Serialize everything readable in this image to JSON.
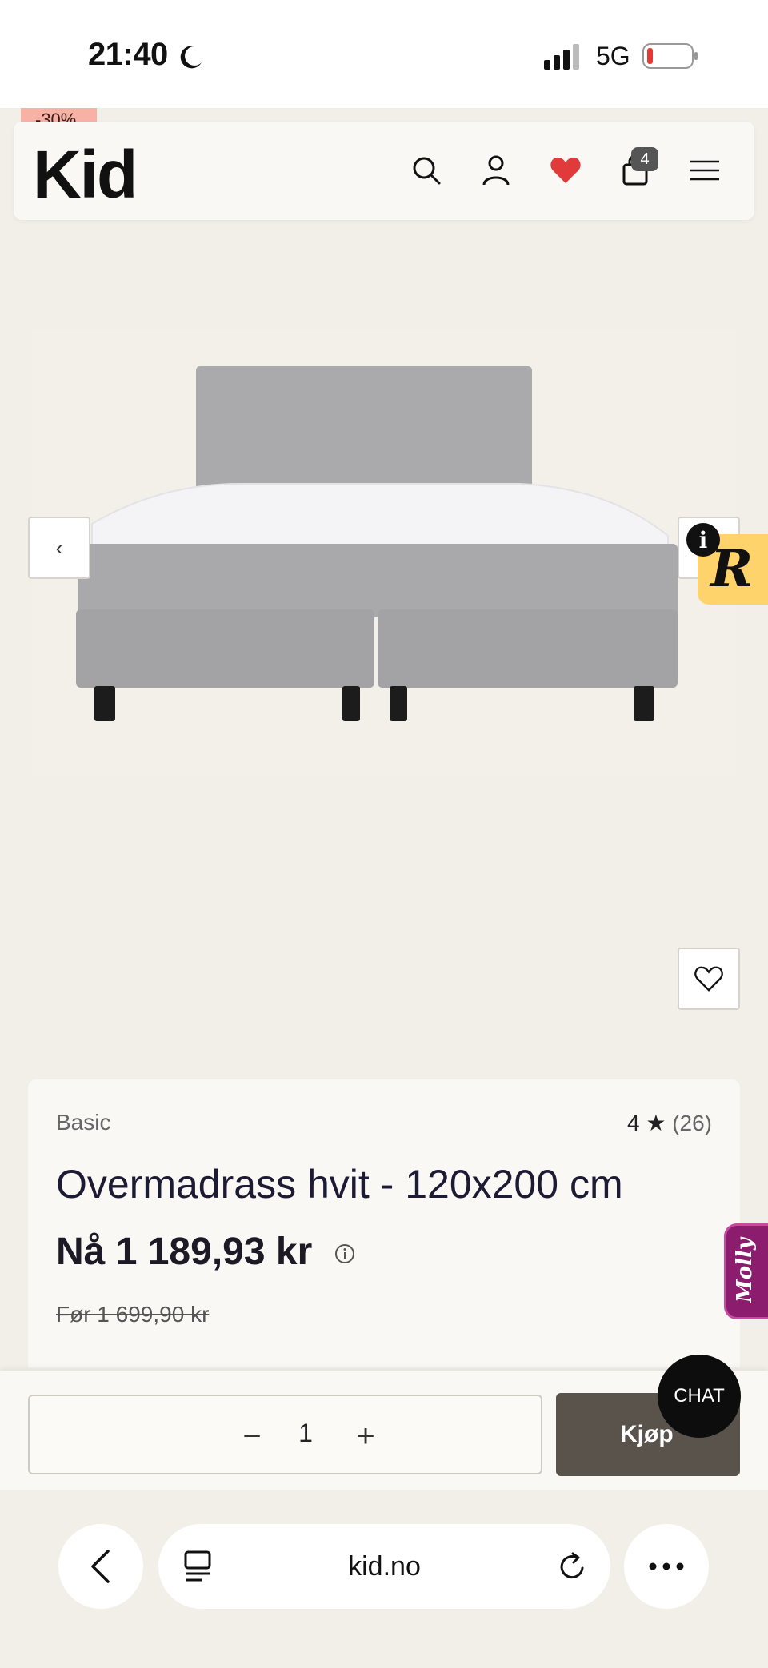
{
  "status_bar": {
    "time": "21:40",
    "network": "5G"
  },
  "sale_badge": "-30%",
  "header": {
    "logo": "Kid",
    "cart_count": "4"
  },
  "product": {
    "brand": "Basic",
    "rating": "4 ★",
    "rating_count": "(26)",
    "title": "Overmadrass hvit - 120x200 cm",
    "price_now": "Nå 1 189,93 kr",
    "price_before": "Før 1 699,90 kr"
  },
  "widgets": {
    "r_letter": "R",
    "molly": "Molly",
    "chat": "CHAT"
  },
  "buy_bar": {
    "quantity": "1",
    "buy_label": "Kjøp"
  },
  "browser": {
    "url": "kid.no"
  },
  "colors": {
    "accent_heart": "#e03a3a",
    "buy_button": "#5a534c",
    "molly": "#8c1d6e",
    "r_widget": "#ffd36b",
    "sale": "#f7b2a5"
  }
}
